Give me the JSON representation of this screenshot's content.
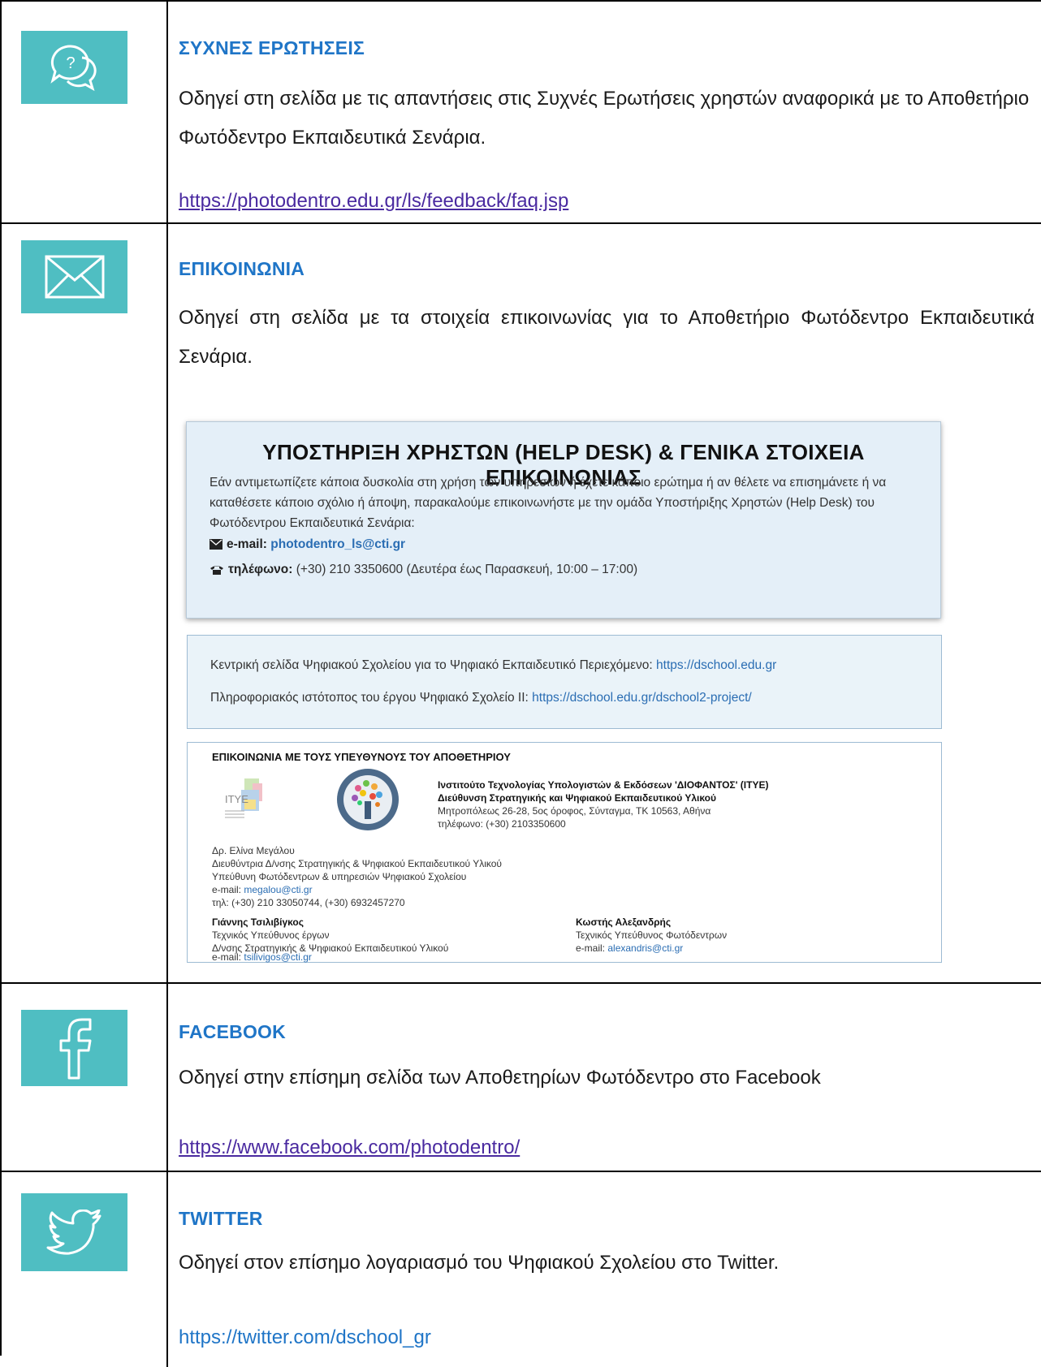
{
  "rows": {
    "faq": {
      "heading": "ΣΥΧΝΕΣ ΕΡΩΤΗΣΕΙΣ",
      "text": "Οδηγεί στη σελίδα με τις απαντήσεις στις Συχνές Ερωτήσεις χρηστών αναφορικά με το Αποθετήριο Φωτόδεντρο Εκπαιδευτικά Σενάρια.",
      "link": "https://photodentro.edu.gr/ls/feedback/faq.jsp",
      "icon": "question-chat-icon"
    },
    "contact": {
      "heading": "ΕΠΙΚΟΙΝΩΝΙΑ",
      "text": "Οδηγεί στη σελίδα με τα στοιχεία επικοινωνίας για το Αποθετήριο Φωτόδεντρο Εκπαιδευτικά Σενάρια.",
      "icon": "envelope-icon"
    },
    "facebook": {
      "heading": "FACEBOOK",
      "text": "Οδηγεί στην επίσημη σελίδα των Αποθετηρίων Φωτόδεντρο στο  Facebook",
      "link": "https://www.facebook.com/photodentro/",
      "icon": "facebook-icon"
    },
    "twitter": {
      "heading": "TWITTER",
      "text": "Οδηγεί στον επίσημο λογαριασμό του Ψηφιακού Σχολείου στο Twitter.",
      "link": "https://twitter.com/dschool_gr",
      "icon": "twitter-bird-icon"
    }
  },
  "helpdesk": {
    "title": "ΥΠΟΣΤΗΡΙΞΗ ΧΡΗΣΤΩΝ (HELP DESK) & ΓΕΝΙΚΑ ΣΤΟΙΧΕΙΑ ΕΠΙΚΟΙΝΩΝΙΑΣ",
    "desc": "Εάν αντιμετωπίζετε κάποια δυσκολία στη χρήση των υπηρεσιών ή έχετε κάποιο ερώτημα ή αν θέλετε να επισημάνετε ή να καταθέσετε κάποιο σχόλιο ή άποψη, παρακαλούμε επικοινωνήστε με την ομάδα Υποστήριξης Χρηστών (Help Desk) του Φωτόδεντρου Εκπαιδευτικά Σενάρια:",
    "email_label": "e-mail:",
    "email": "photodentro_ls@cti.gr",
    "phone_label": "τηλέφωνο:",
    "phone": "(+30) 210 3350600 (Δευτέρα έως Παρασκευή, 10:00 – 17:00)"
  },
  "dschool": {
    "line1_text": "Κεντρική σελίδα Ψηφιακού Σχολείου για το Ψηφιακό Εκπαιδευτικό Περιεχόμενο:",
    "line1_link": "https://dschool.edu.gr",
    "line2_text": "Πληροφοριακός ιστότοπος του έργου Ψηφιακό Σχολείο ΙΙ:",
    "line2_link": "https://dschool.edu.gr/dschool2-project/"
  },
  "responsibles": {
    "title": "ΕΠΙΚΟΙΝΩΝΙΑ ΜΕ ΤΟΥΣ ΥΠΕΥΘΥΝΟΥΣ ΤΟΥ ΑΠΟΘΕΤΗΡΙΟΥ",
    "logo1_text": "ΙΤΥΕ",
    "org_name": "Ινστιτούτο Τεχνολογίας Υπολογιστών & Εκδόσεων 'ΔΙΟΦΑΝΤΟΣ' (ΙΤΥΕ)",
    "org_dept": "Διεύθυνση Στρατηγικής και Ψηφιακού Εκπαιδευτικού Υλικού",
    "org_address": "Μητροπόλεως 26-28, 5ος όροφος, Σύνταγμα, ΤΚ 10563, Αθήνα",
    "org_phone": "τηλέφωνο: (+30) 2103350600",
    "p1_name": "Δρ. Ελίνα Μεγάλου",
    "p1_role1": "Διευθύντρια Δ/νσης Στρατηγικής & Ψηφιακού Εκπαιδευτικού Υλικού",
    "p1_role2": "Υπεύθυνη Φωτόδεντρων & υπηρεσιών Ψηφιακού Σχολείου",
    "p1_email_label": "e-mail:",
    "p1_email": "megalou@cti.gr",
    "p1_phone": "τηλ: (+30) 210 33050744, (+30) 6932457270",
    "p2_name": "Γιάννης Τσιλιβίγκος",
    "p2_role1": "Τεχνικός Υπεύθυνος έργων",
    "p2_role2": "Δ/νσης Στρατηγικής & Ψηφιακού Εκπαιδευτικού Υλικού",
    "p2_email_label": "e-mail:",
    "p2_email": "tsilivigos@cti.gr",
    "p3_name": "Κωστής Αλεξανδρής",
    "p3_role1": "Τεχνικός Υπεύθυνος Φωτόδεντρων",
    "p3_email_label": "e-mail:",
    "p3_email": "alexandris@cti.gr"
  },
  "colors": {
    "icon_bg": "#4fbec2",
    "heading": "#1f75c7",
    "link_visited": "#4a2aa0"
  }
}
